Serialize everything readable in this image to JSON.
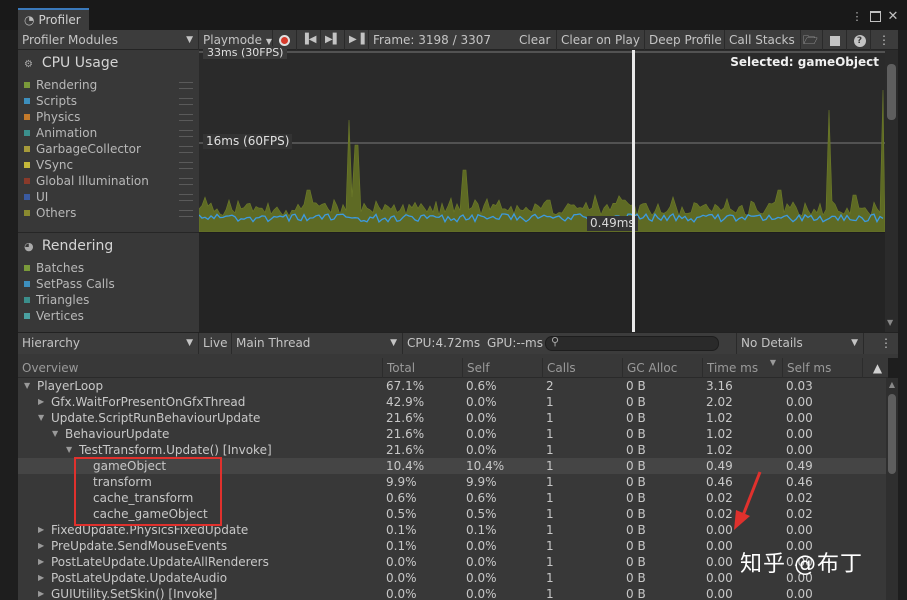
{
  "window": {
    "tab_title": "Profiler",
    "menu_icon": "kebab-icon",
    "maximize_icon": "square-icon",
    "close_icon": "close-icon"
  },
  "toolbar": {
    "modules_dropdown": "Profiler Modules",
    "playmode": "Playmode",
    "frame_label": "Frame: 3198 / 3307",
    "clear": "Clear",
    "clear_on_play": "Clear on Play",
    "deep_profile": "Deep Profile",
    "call_stacks": "Call Stacks"
  },
  "modules": {
    "cpu": {
      "title": "CPU Usage",
      "items": [
        {
          "label": "Rendering",
          "color": "#7a9a3a"
        },
        {
          "label": "Scripts",
          "color": "#3d8fbd"
        },
        {
          "label": "Physics",
          "color": "#c47a2b"
        },
        {
          "label": "Animation",
          "color": "#3b8f8c"
        },
        {
          "label": "GarbageCollector",
          "color": "#a69a3a"
        },
        {
          "label": "VSync",
          "color": "#c5b83a"
        },
        {
          "label": "Global Illumination",
          "color": "#8a3a2a"
        },
        {
          "label": "UI",
          "color": "#3a5aa0"
        },
        {
          "label": "Others",
          "color": "#8a8a30"
        }
      ]
    },
    "rendering": {
      "title": "Rendering",
      "items": [
        {
          "label": "Batches",
          "color": "#7a9a3a"
        },
        {
          "label": "SetPass Calls",
          "color": "#3d8fbd"
        },
        {
          "label": "Triangles",
          "color": "#3b8f8c"
        },
        {
          "label": "Vertices",
          "color": "#4aa0a0"
        }
      ]
    }
  },
  "chart": {
    "label_33": "33ms (30FPS)",
    "label_16": "16ms (60FPS)",
    "selected": "Selected: gameObject",
    "cursor_value": "0.49ms"
  },
  "hierarchy_bar": {
    "view": "Hierarchy",
    "live": "Live",
    "thread": "Main Thread",
    "cpu": "CPU:4.72ms",
    "gpu": "GPU:--ms",
    "search_placeholder": "",
    "details": "No Details"
  },
  "table": {
    "headers": [
      "Overview",
      "Total",
      "Self",
      "Calls",
      "GC Alloc",
      "Time ms",
      "Self ms"
    ],
    "rows": [
      {
        "name": "PlayerLoop",
        "indent": 0,
        "toggle": "▼",
        "total": "67.1%",
        "self": "0.6%",
        "calls": "2",
        "gc": "0 B",
        "time": "3.16",
        "selfms": "0.03"
      },
      {
        "name": "Gfx.WaitForPresentOnGfxThread",
        "indent": 1,
        "toggle": "▶",
        "total": "42.9%",
        "self": "0.0%",
        "calls": "1",
        "gc": "0 B",
        "time": "2.02",
        "selfms": "0.00"
      },
      {
        "name": "Update.ScriptRunBehaviourUpdate",
        "indent": 1,
        "toggle": "▼",
        "total": "21.6%",
        "self": "0.0%",
        "calls": "1",
        "gc": "0 B",
        "time": "1.02",
        "selfms": "0.00"
      },
      {
        "name": "BehaviourUpdate",
        "indent": 2,
        "toggle": "▼",
        "total": "21.6%",
        "self": "0.0%",
        "calls": "1",
        "gc": "0 B",
        "time": "1.02",
        "selfms": "0.00"
      },
      {
        "name": "TestTransform.Update() [Invoke]",
        "indent": 3,
        "toggle": "▼",
        "total": "21.6%",
        "self": "0.0%",
        "calls": "1",
        "gc": "0 B",
        "time": "1.02",
        "selfms": "0.00"
      },
      {
        "name": "gameObject",
        "indent": 4,
        "toggle": "",
        "total": "10.4%",
        "self": "10.4%",
        "calls": "1",
        "gc": "0 B",
        "time": "0.49",
        "selfms": "0.49",
        "selected": true
      },
      {
        "name": "transform",
        "indent": 4,
        "toggle": "",
        "total": "9.9%",
        "self": "9.9%",
        "calls": "1",
        "gc": "0 B",
        "time": "0.46",
        "selfms": "0.46"
      },
      {
        "name": "cache_transform",
        "indent": 4,
        "toggle": "",
        "total": "0.6%",
        "self": "0.6%",
        "calls": "1",
        "gc": "0 B",
        "time": "0.02",
        "selfms": "0.02"
      },
      {
        "name": "cache_gameObject",
        "indent": 4,
        "toggle": "",
        "total": "0.5%",
        "self": "0.5%",
        "calls": "1",
        "gc": "0 B",
        "time": "0.02",
        "selfms": "0.02"
      },
      {
        "name": "FixedUpdate.PhysicsFixedUpdate",
        "indent": 1,
        "toggle": "▶",
        "total": "0.1%",
        "self": "0.1%",
        "calls": "1",
        "gc": "0 B",
        "time": "0.00",
        "selfms": "0.00"
      },
      {
        "name": "PreUpdate.SendMouseEvents",
        "indent": 1,
        "toggle": "▶",
        "total": "0.1%",
        "self": "0.0%",
        "calls": "1",
        "gc": "0 B",
        "time": "0.00",
        "selfms": "0.00"
      },
      {
        "name": "PostLateUpdate.UpdateAllRenderers",
        "indent": 1,
        "toggle": "▶",
        "total": "0.0%",
        "self": "0.0%",
        "calls": "1",
        "gc": "0 B",
        "time": "0.00",
        "selfms": "0.00"
      },
      {
        "name": "PostLateUpdate.UpdateAudio",
        "indent": 1,
        "toggle": "▶",
        "total": "0.0%",
        "self": "0.0%",
        "calls": "1",
        "gc": "0 B",
        "time": "0.00",
        "selfms": "0.00"
      },
      {
        "name": "GUIUtility.SetSkin() [Invoke]",
        "indent": 1,
        "toggle": "▶",
        "total": "0.0%",
        "self": "0.0%",
        "calls": "1",
        "gc": "0 B",
        "time": "0.00",
        "selfms": "0.00"
      }
    ]
  },
  "watermark": "知乎 @布丁",
  "colors": {
    "annotation_red": "#e0312d",
    "accent_blue": "#3a79bb",
    "cpu_fill": "#5e6a24",
    "script_line": "#3d9be0"
  }
}
